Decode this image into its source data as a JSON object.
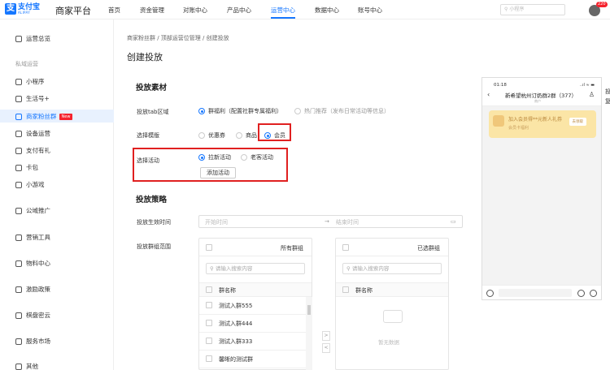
{
  "header": {
    "logo_cn": "支付宝",
    "logo_en": "ALIPAY",
    "platform": "商家平台",
    "nav": [
      "首页",
      "资金管理",
      "对账中心",
      "产品中心",
      "运营中心",
      "数据中心",
      "账号中心"
    ],
    "active_nav": "运营中心",
    "search_placeholder": "小程序",
    "badge": "220"
  },
  "sidebar": {
    "overview": "运营总览",
    "group": "私域运营",
    "items": [
      {
        "label": "小程序",
        "icon": "mini-program-icon"
      },
      {
        "label": "生活号+",
        "icon": "life-account-icon"
      },
      {
        "label": "商家粉丝群",
        "icon": "fan-group-icon",
        "tag": "New"
      },
      {
        "label": "设备运营",
        "icon": "device-icon"
      },
      {
        "label": "支付有礼",
        "icon": "gift-icon"
      },
      {
        "label": "卡包",
        "icon": "card-icon"
      },
      {
        "label": "小游戏",
        "icon": "game-icon"
      }
    ],
    "lower": [
      {
        "label": "公域推广",
        "icon": "promo-icon"
      },
      {
        "label": "营销工具",
        "icon": "marketing-icon"
      },
      {
        "label": "物料中心",
        "icon": "material-icon"
      },
      {
        "label": "激励政策",
        "icon": "incentive-icon"
      },
      {
        "label": "棋盘密云",
        "icon": "cloud-icon"
      },
      {
        "label": "服务市场",
        "icon": "market-icon"
      },
      {
        "label": "其他",
        "icon": "other-icon"
      }
    ]
  },
  "main": {
    "breadcrumb": "商家粉丝群  /  顶部运营位管理  /  创建投放",
    "title": "创建投放",
    "section1": "投放素材",
    "tab_label": "投放tab区域",
    "tab_options": [
      "群福利（配置社群专属福利）",
      "热门推荐（发布日常活动等信息）"
    ],
    "template_label": "选择模版",
    "template_options": [
      "优惠券",
      "商品",
      "会员"
    ],
    "activity_label": "选择活动",
    "activity_options": [
      "拉新活动",
      "老客活动"
    ],
    "add_activity": "添加活动",
    "section2": "投放策略",
    "time_label": "投放生效时间",
    "start_placeholder": "开始时间",
    "end_placeholder": "结束时间",
    "arrow": "→",
    "range_label": "投放群组范围",
    "all_groups": "所有群组",
    "selected_groups": "已选群组",
    "search_placeholder": "请输入搜索内容",
    "col_name": "群名称",
    "groups": [
      "测试入群555",
      "测试入群444",
      "测试入群333",
      "馨晰的测试群"
    ],
    "empty": "暂无数据"
  },
  "phone": {
    "time": "01:18",
    "signal": "..ıl ≈ ▬",
    "title": "新希望杭州订奶群2群（377）",
    "subtitle": "商户",
    "card_title": "加入会员得**元新人礼券",
    "card_sub": "会员卡福利",
    "card_btn": "去领取"
  },
  "edge": [
    "投",
    "复"
  ]
}
